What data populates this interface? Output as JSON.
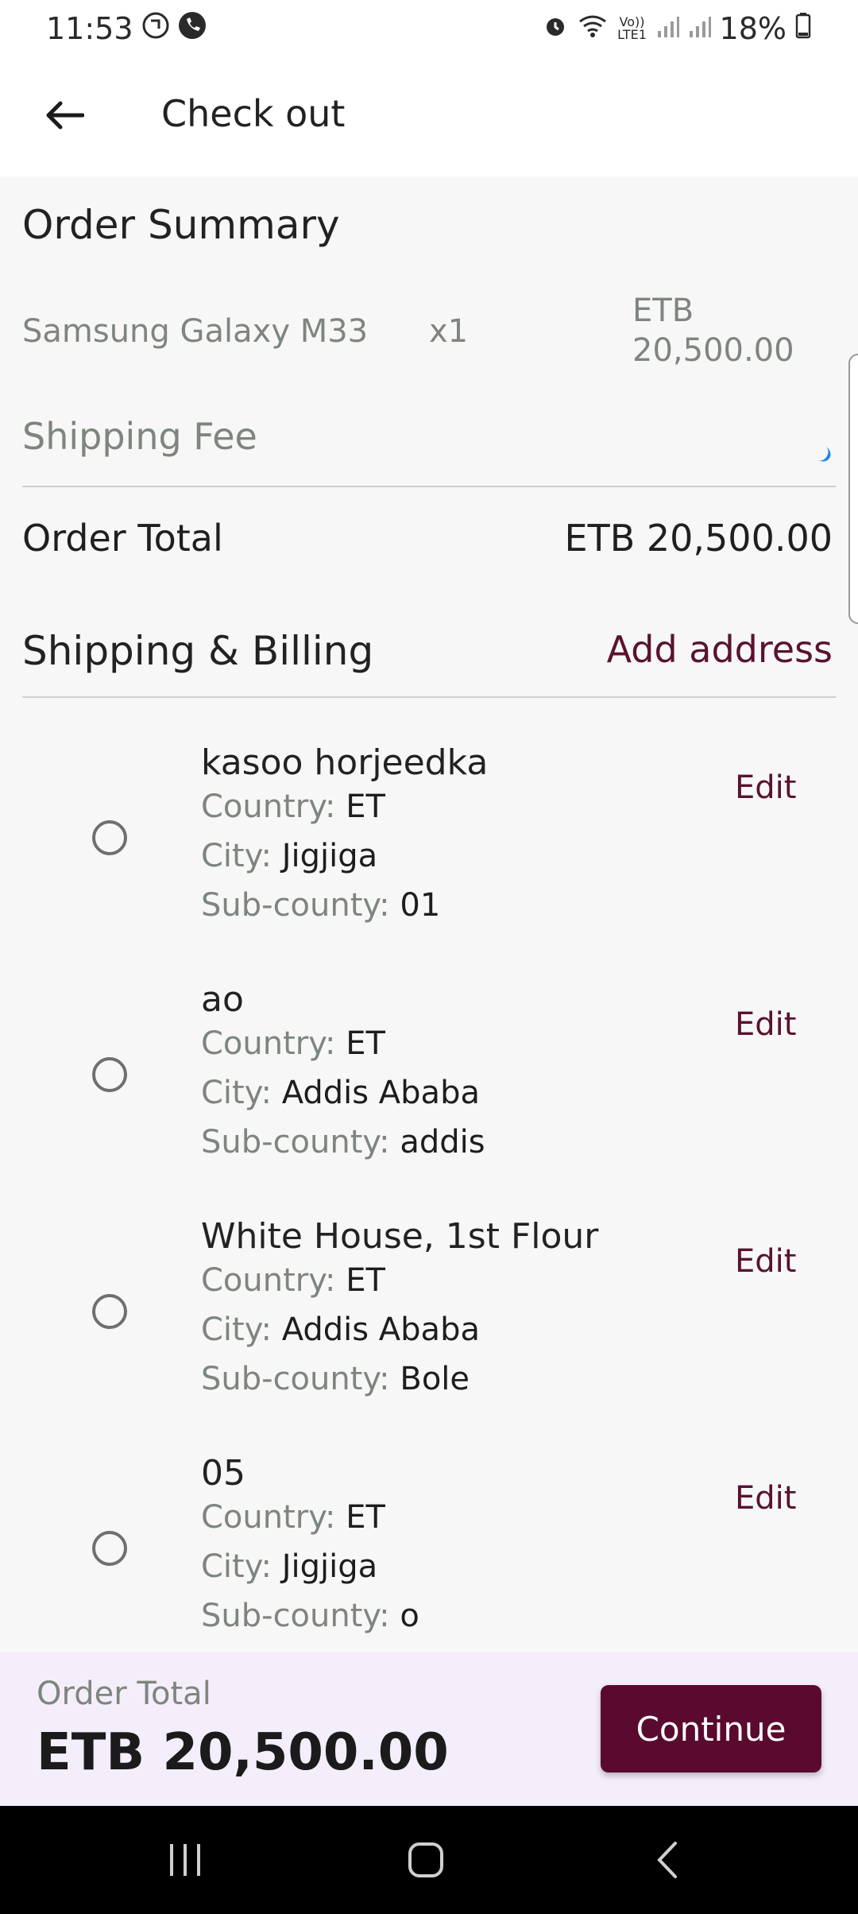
{
  "status": {
    "time": "11:53",
    "battery": "18%",
    "left_icons": [
      "call-forward-icon",
      "phone-icon"
    ],
    "right_icons": [
      "alarm-icon",
      "wifi-icon",
      "volte-icon",
      "signal-icon",
      "signal-icon",
      "battery-icon"
    ],
    "volte_text": "Vo)) LTE1"
  },
  "header": {
    "title": "Check out",
    "back_icon": "arrow-left-icon"
  },
  "summary": {
    "title": "Order Summary",
    "item_name": "Samsung Galaxy M33",
    "item_qty": "x1",
    "item_price_line1": "ETB",
    "item_price_line2": "20,500.00",
    "shipping_label": "Shipping Fee",
    "total_label": "Order Total",
    "total_value": "ETB 20,500.00"
  },
  "shipping": {
    "title": "Shipping & Billing",
    "add_label": "Add address",
    "labels": {
      "country": "Country: ",
      "city": "City: ",
      "subcounty": "Sub-county: "
    },
    "edit_label": "Edit",
    "addresses": [
      {
        "title": "kasoo horjeedka",
        "country": "ET",
        "city": "Jigjiga",
        "subcounty": "01"
      },
      {
        "title": "ao",
        "country": "ET",
        "city": "Addis Ababa",
        "subcounty": "addis"
      },
      {
        "title": "White House, 1st Flour",
        "country": "ET",
        "city": "Addis Ababa",
        "subcounty": "Bole"
      },
      {
        "title": "05",
        "country": "ET",
        "city": "Jigjiga",
        "subcounty": "o"
      }
    ]
  },
  "bottom": {
    "label": "Order Total",
    "value": "ETB 20,500.00",
    "button": "Continue"
  },
  "colors": {
    "accent": "#5a0a2e",
    "link": "#5a1230",
    "muted": "#7e857e",
    "panel": "#f4eefb"
  },
  "nav": {
    "icons": [
      "recent-apps-icon",
      "home-icon",
      "back-icon"
    ]
  }
}
